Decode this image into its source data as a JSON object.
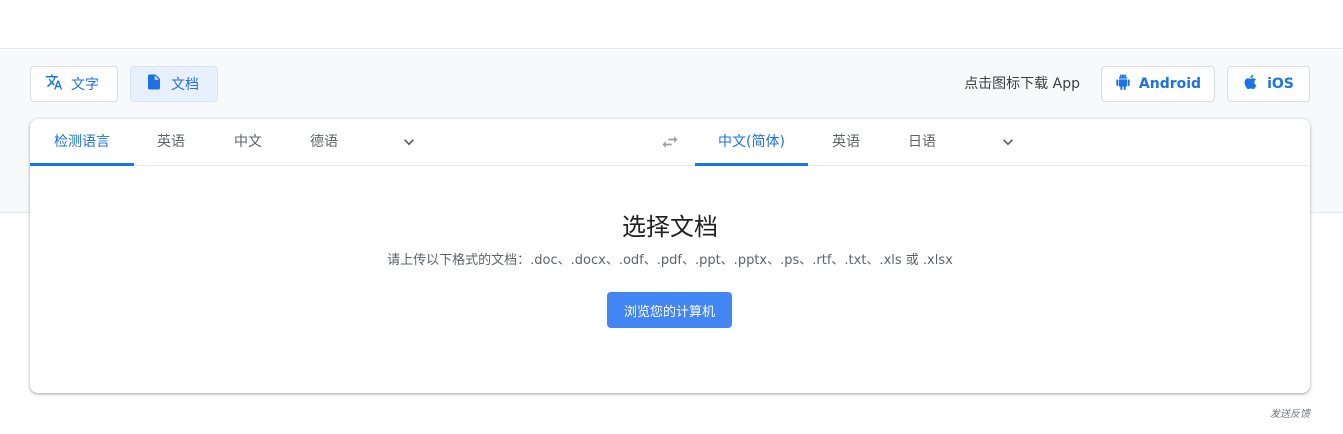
{
  "mode_tabs": [
    {
      "label": "文字",
      "icon": "translate-icon"
    },
    {
      "label": "文档",
      "icon": "document-icon"
    }
  ],
  "download": {
    "label": "点击图标下载 App",
    "android_label": "Android",
    "ios_label": "iOS"
  },
  "source_langs": [
    "检测语言",
    "英语",
    "中文",
    "德语"
  ],
  "target_langs": [
    "中文(简体)",
    "英语",
    "日语"
  ],
  "document": {
    "title": "选择文档",
    "subtitle": "请上传以下格式的文档：.doc、.docx、.odf、.pdf、.ppt、.pptx、.ps、.rtf、.txt、.xls 或 .xlsx",
    "browse_label": "浏览您的计算机"
  },
  "feedback_label": "发送反馈",
  "colors": {
    "accent": "#1a73e8",
    "button": "#4285f4",
    "active_bg": "#e8f0fe"
  }
}
